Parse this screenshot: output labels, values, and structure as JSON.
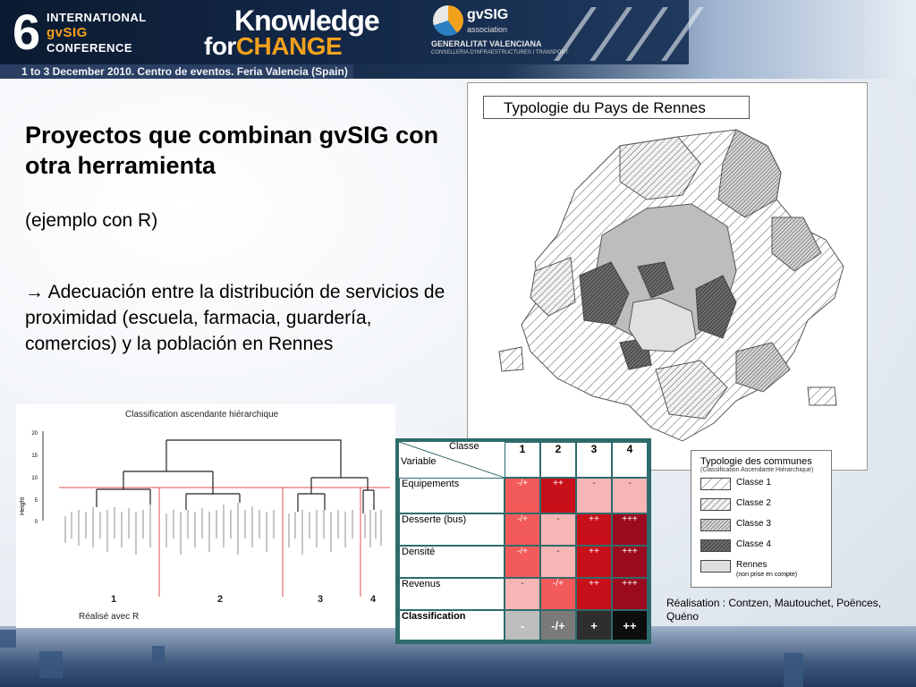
{
  "banner": {
    "number": "6",
    "line1": "INTERNATIONAL",
    "line2": "gvSIG",
    "line3": "CONFERENCE",
    "knowledge": "Knowledge",
    "for": "for",
    "change": "CHANGE",
    "gvsig_name": "gvSIG",
    "gvsig_assoc": "association",
    "generalitat": "GENERALITAT VALENCIANA",
    "generalitat_sub": "CONSELLERIA D'INFRAESTRUCTURES I TRANSPORT",
    "date_line": "1 to 3 December 2010. Centro de eventos. Feria Valencia (Spain)"
  },
  "slide": {
    "title": "Proyectos que combinan gvSIG con otra herramienta",
    "subtitle": "(ejemplo con R)",
    "body": "→ Adecuación entre la distribución de servicios de proximidad (escuela, farmacia, guardería, comercios) y la población en Rennes"
  },
  "map": {
    "title": "Typologie du Pays de Rennes"
  },
  "legend": {
    "title": "Typologie des communes",
    "subtitle": "(Classification Ascendante Hiérarchique)",
    "items": [
      {
        "label": "Classe 1",
        "style": "light-hatch"
      },
      {
        "label": "Classe 2",
        "style": "medium-hatch"
      },
      {
        "label": "Classe 3",
        "style": "dense-hatch"
      },
      {
        "label": "Classe 4",
        "style": "dark-hatch"
      },
      {
        "label": "Rennes",
        "style": "light-grey"
      }
    ],
    "note": "(non prise en compte)"
  },
  "credit": "Réalisation : Contzen, Mautouchet, Poënces, Quéno",
  "dendrogram": {
    "title": "Classification ascendante hiérarchique",
    "y_label": "Height",
    "y_ticks": [
      "20",
      "15",
      "10",
      "5",
      "0"
    ],
    "cluster_labels": [
      "1",
      "2",
      "3",
      "4"
    ],
    "footer": "Réalisé avec R"
  },
  "table": {
    "corner_top": "Classe",
    "corner_bottom": "Variable",
    "columns": [
      "1",
      "2",
      "3",
      "4"
    ],
    "rows": [
      {
        "label": "Equipements",
        "cells": [
          "-/+",
          "++",
          "-",
          "-"
        ]
      },
      {
        "label": "Desserte (bus)",
        "cells": [
          "-/+",
          "-",
          "++",
          "+++"
        ]
      },
      {
        "label": "Densité",
        "cells": [
          "-/+",
          "-",
          "++",
          "+++"
        ]
      },
      {
        "label": "Revenus",
        "cells": [
          "-",
          "-/+",
          "++",
          "+++"
        ]
      },
      {
        "label": "Classification",
        "cells": [
          "-",
          "-/+",
          "+",
          "++"
        ]
      }
    ],
    "colors": {
      "-/+": "#f35a5a",
      "++": "#c8101a",
      "+++": "#9b0b1e",
      "-": "#f7b5b5"
    },
    "class_colors": [
      "#bdbdbd",
      "#7a7a7a",
      "#2e2e2e",
      "#0d0d0d"
    ]
  }
}
